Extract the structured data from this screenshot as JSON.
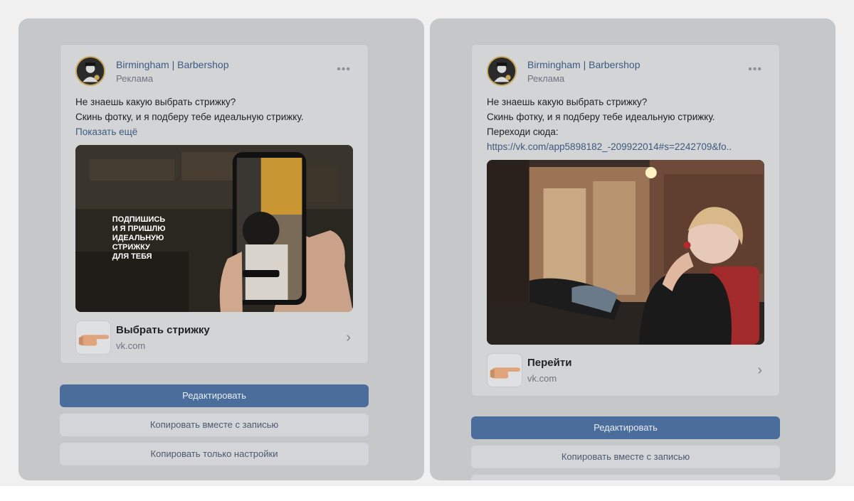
{
  "left": {
    "post": {
      "author": "Birmingham | Barbershop",
      "sublabel": "Реклама",
      "menu_label": "•••",
      "text_lines": [
        "Не знаешь какую выбрать стрижку?",
        "Скинь фотку, и я подберу тебе идеальную стрижку."
      ],
      "show_more": "Показать ещё",
      "image_caption_lines": [
        "ПОДПИШИСЬ",
        "И Я ПРИШЛЮ",
        "ИДЕАЛЬНУЮ",
        "СТРИЖКУ",
        "ДЛЯ ТЕБЯ"
      ],
      "cta_title": "Выбрать стрижку",
      "cta_domain": "vk.com",
      "chevron": "›"
    },
    "buttons": {
      "edit": "Редактировать",
      "copy_with_post": "Копировать вместе с записью",
      "copy_settings": "Копировать только настройки"
    }
  },
  "right": {
    "post": {
      "author": "Birmingham | Barbershop",
      "sublabel": "Реклама",
      "menu_label": "•••",
      "text_lines": [
        "Не знаешь какую выбрать стрижку?",
        "Скинь фотку, и я подберу тебе идеальную стрижку.",
        "Переходи сюда:"
      ],
      "link": "https://vk.com/app5898182_-209922014#s=2242709&fo..",
      "cta_title": "Перейти",
      "cta_domain": "vk.com",
      "chevron": "›"
    },
    "buttons": {
      "edit": "Редактировать",
      "copy_with_post": "Копировать вместе с записью"
    }
  },
  "colors": {
    "accent_button": "#4b6d9b",
    "link": "#3d5a80",
    "overlay": "#c6c7c9"
  }
}
